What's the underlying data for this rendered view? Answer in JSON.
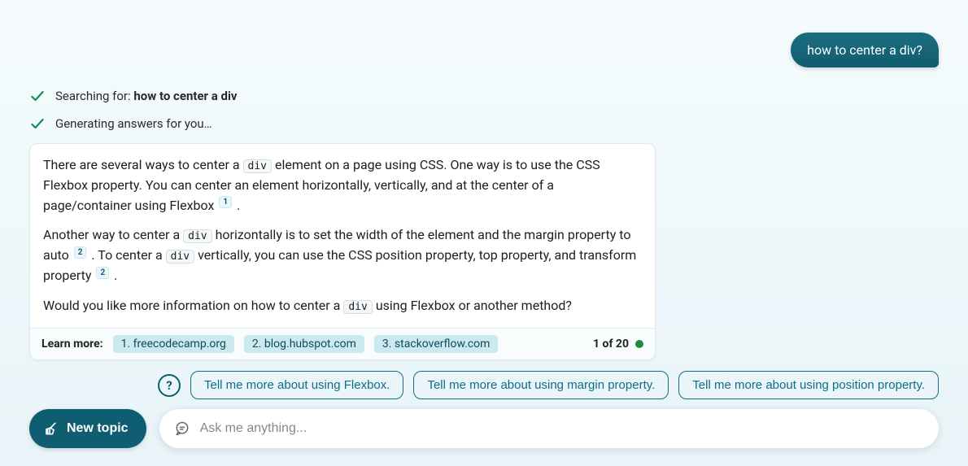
{
  "user_message": "how to center a div?",
  "status": {
    "searching_prefix": "Searching for: ",
    "searching_query": "how to center a div",
    "generating": "Generating answers for you…"
  },
  "answer": {
    "p1_a": "There are several ways to center a ",
    "code_div": "div",
    "p1_b": " element on a page using CSS. One way is to use the CSS Flexbox property. You can center an element horizontally, vertically, and at the center of a page/container using Flexbox ",
    "cite1": "1",
    "p1_c": " .",
    "p2_a": "Another way to center a ",
    "p2_b": " horizontally is to set the width of the element and the margin property to auto ",
    "cite2": "2",
    "p2_c": " . To center a ",
    "p2_d": " vertically, you can use the CSS position property, top property, and transform property ",
    "p2_e": " .",
    "p3_a": "Would you like more information on how to center a ",
    "p3_b": " using Flexbox or another method?"
  },
  "learn_more": {
    "label": "Learn more:",
    "sources": [
      "1. freecodecamp.org",
      "2. blog.hubspot.com",
      "3. stackoverflow.com"
    ],
    "counter": "1 of 20"
  },
  "suggestions": [
    "Tell me more about using Flexbox.",
    "Tell me more about using margin property.",
    "Tell me more about using position property."
  ],
  "help_glyph": "?",
  "bottom": {
    "new_topic": "New topic",
    "placeholder": "Ask me anything..."
  }
}
